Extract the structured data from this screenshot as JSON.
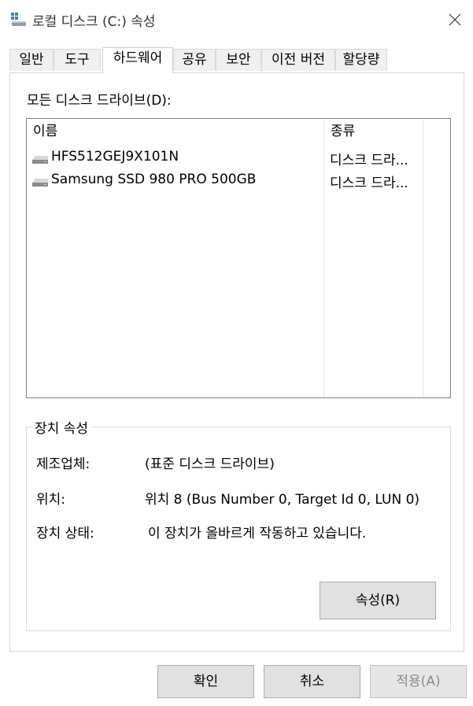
{
  "window": {
    "title": "로컬 디스크 (C:) 속성",
    "icon": "drive-icon"
  },
  "tabs": [
    {
      "label": "일반",
      "active": false
    },
    {
      "label": "도구",
      "active": false
    },
    {
      "label": "하드웨어",
      "active": true
    },
    {
      "label": "공유",
      "active": false
    },
    {
      "label": "보안",
      "active": false
    },
    {
      "label": "이전 버전",
      "active": false
    },
    {
      "label": "할당량",
      "active": false
    }
  ],
  "hardware": {
    "all_drives_label": "모든 디스크 드라이브(D):",
    "columns": {
      "name": "이름",
      "type": "종류"
    },
    "drives": [
      {
        "name": "HFS512GEJ9X101N",
        "type": "디스크 드라..."
      },
      {
        "name": "Samsung SSD 980 PRO 500GB",
        "type": "디스크 드라..."
      }
    ]
  },
  "device_properties": {
    "group_title": "장치 속성",
    "manufacturer_label": "제조업체:",
    "manufacturer_value": "(표준 디스크 드라이브)",
    "location_label": "위치:",
    "location_value": "위치 8 (Bus Number 0, Target Id 0, LUN 0)",
    "status_label": "장치 상태:",
    "status_value": "이 장치가 올바르게 작동하고 있습니다.",
    "properties_button": "속성(R)"
  },
  "footer": {
    "ok": "확인",
    "cancel": "취소",
    "apply": "적용(A)"
  }
}
